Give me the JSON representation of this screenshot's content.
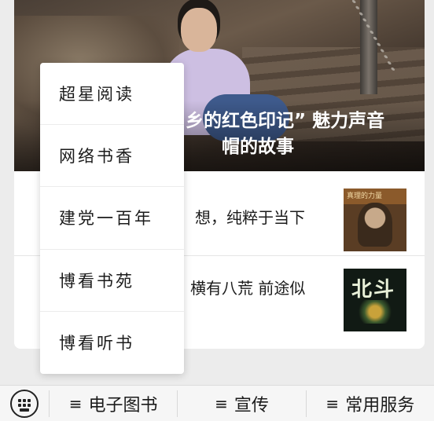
{
  "hero": {
    "caption_line1": "乡的红色印记” 魅力声音",
    "caption_line2": "帽的故事"
  },
  "articles": [
    {
      "title_line1": "想，纯粹于当下",
      "thumb_text": "真理的力量"
    },
    {
      "title_line1": "横有八荒 前途似",
      "thumb_text": "北斗"
    }
  ],
  "popup_menu": {
    "items": [
      {
        "label": "超星阅读"
      },
      {
        "label": "网络书香"
      },
      {
        "label": "建党一百年"
      },
      {
        "label": "博看书苑"
      },
      {
        "label": "博看听书"
      }
    ]
  },
  "bottom_bar": {
    "keyboard_icon": "keyboard-icon",
    "menu_icon": "≡",
    "tabs": [
      {
        "label": "电子图书"
      },
      {
        "label": "宣传"
      },
      {
        "label": "常用服务"
      }
    ]
  }
}
